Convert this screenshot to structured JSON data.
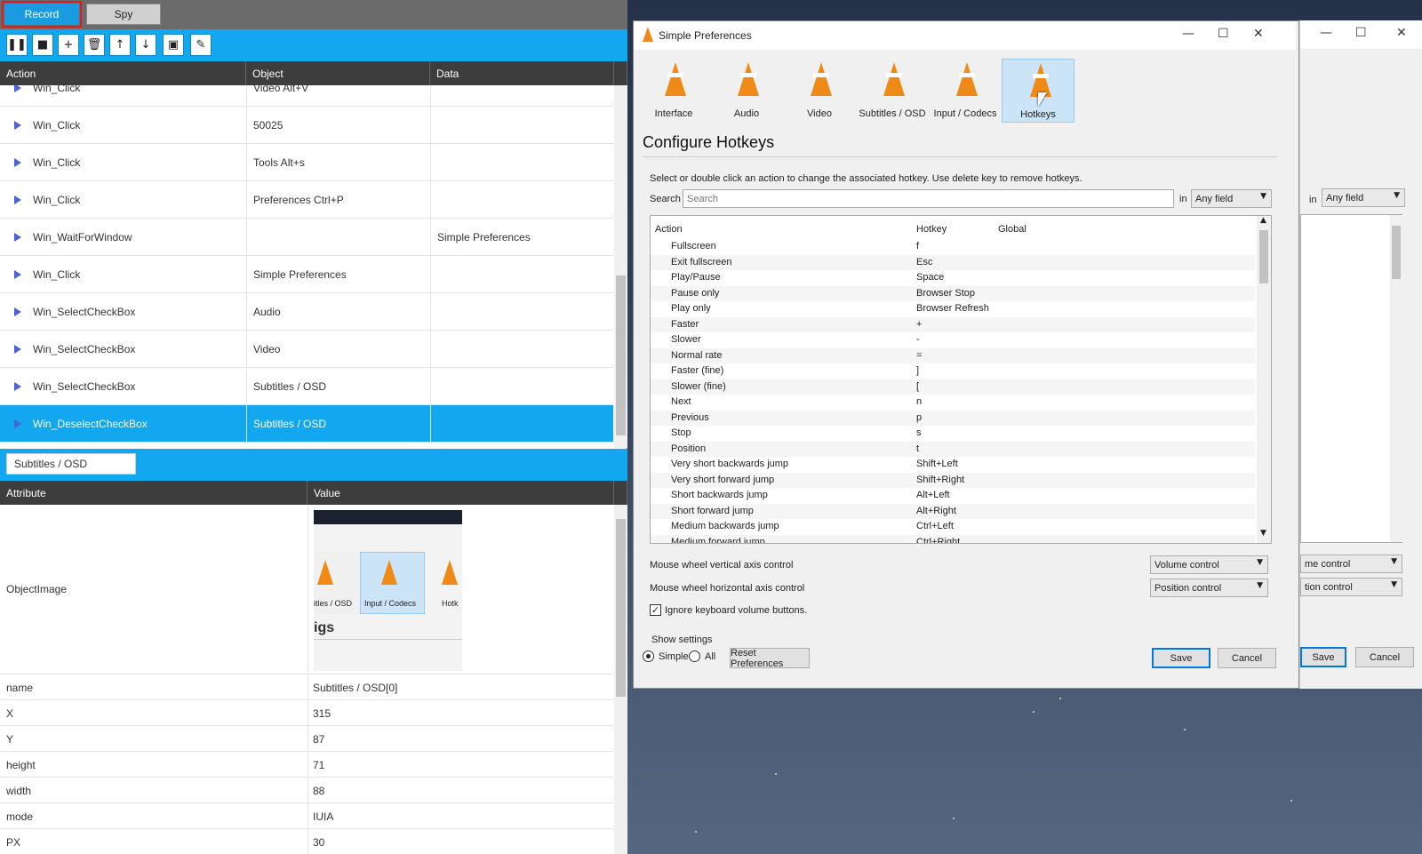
{
  "recorder": {
    "tabs": {
      "record": "Record",
      "spy": "Spy"
    },
    "toolbar": [
      "pause-icon",
      "stop-icon",
      "add-icon",
      "delete-icon",
      "move-up-icon",
      "move-down-icon",
      "image-icon",
      "picker-icon"
    ],
    "columns": {
      "action": "Action",
      "object": "Object",
      "data": "Data"
    },
    "rows": [
      {
        "action": "Win_Click",
        "object": "Video Alt+V",
        "data": ""
      },
      {
        "action": "Win_Click",
        "object": "50025",
        "data": ""
      },
      {
        "action": "Win_Click",
        "object": "Tools Alt+s",
        "data": ""
      },
      {
        "action": "Win_Click",
        "object": "Preferences Ctrl+P",
        "data": ""
      },
      {
        "action": "Win_WaitForWindow",
        "object": "",
        "data": "Simple Preferences"
      },
      {
        "action": "Win_Click",
        "object": "Simple Preferences",
        "data": ""
      },
      {
        "action": "Win_SelectCheckBox",
        "object": "Audio",
        "data": ""
      },
      {
        "action": "Win_SelectCheckBox",
        "object": "Video",
        "data": ""
      },
      {
        "action": "Win_SelectCheckBox",
        "object": "Subtitles / OSD",
        "data": ""
      },
      {
        "action": "Win_DeselectCheckBox",
        "object": "Subtitles / OSD",
        "data": ""
      }
    ],
    "selected_object": "Subtitles / OSD",
    "attr_columns": {
      "attribute": "Attribute",
      "value": "Value"
    },
    "object_image": {
      "label": "ObjectImage",
      "thumb_labels": [
        "itles / OSD",
        "Input / Codecs",
        "Hotk"
      ],
      "thumb_heading": "igs"
    },
    "attributes": [
      {
        "name": "name",
        "value": "Subtitles / OSD[0]"
      },
      {
        "name": "X",
        "value": "315"
      },
      {
        "name": "Y",
        "value": "87"
      },
      {
        "name": "height",
        "value": "71"
      },
      {
        "name": "width",
        "value": "88"
      },
      {
        "name": "mode",
        "value": "IUIA"
      },
      {
        "name": "PX",
        "value": "30"
      }
    ]
  },
  "vlc": {
    "title": "Simple Preferences",
    "nav": [
      "Interface",
      "Audio",
      "Video",
      "Subtitles / OSD",
      "Input / Codecs",
      "Hotkeys"
    ],
    "heading": "Configure Hotkeys",
    "instructions": "Select or double click an action to change the associated hotkey. Use delete key to remove hotkeys.",
    "search_label": "Search",
    "search_placeholder": "Search",
    "in_label": "in",
    "in_value": "Any field",
    "columns": {
      "action": "Action",
      "hotkey": "Hotkey",
      "global": "Global"
    },
    "hotkeys": [
      {
        "action": "Fullscreen",
        "hotkey": "f"
      },
      {
        "action": "Exit fullscreen",
        "hotkey": "Esc"
      },
      {
        "action": "Play/Pause",
        "hotkey": "Space"
      },
      {
        "action": "Pause only",
        "hotkey": "Browser Stop"
      },
      {
        "action": "Play only",
        "hotkey": "Browser Refresh"
      },
      {
        "action": "Faster",
        "hotkey": "+"
      },
      {
        "action": "Slower",
        "hotkey": "-"
      },
      {
        "action": "Normal rate",
        "hotkey": "="
      },
      {
        "action": "Faster (fine)",
        "hotkey": "]"
      },
      {
        "action": "Slower (fine)",
        "hotkey": "["
      },
      {
        "action": "Next",
        "hotkey": "n"
      },
      {
        "action": "Previous",
        "hotkey": "p"
      },
      {
        "action": "Stop",
        "hotkey": "s"
      },
      {
        "action": "Position",
        "hotkey": "t"
      },
      {
        "action": "Very short backwards jump",
        "hotkey": "Shift+Left"
      },
      {
        "action": "Very short forward jump",
        "hotkey": "Shift+Right"
      },
      {
        "action": "Short backwards jump",
        "hotkey": "Alt+Left"
      },
      {
        "action": "Short forward jump",
        "hotkey": "Alt+Right"
      },
      {
        "action": "Medium backwards jump",
        "hotkey": "Ctrl+Left"
      },
      {
        "action": "Medium forward jump",
        "hotkey": "Ctrl+Right"
      }
    ],
    "mouse_vertical_label": "Mouse wheel vertical axis control",
    "mouse_vertical_value": "Volume control",
    "mouse_horizontal_label": "Mouse wheel horizontal axis control",
    "mouse_horizontal_value": "Position control",
    "ignore_keyboard_label": "Ignore keyboard volume buttons.",
    "show_settings_label": "Show settings",
    "simple_label": "Simple",
    "all_label": "All",
    "reset_label": "Reset Preferences",
    "save_label": "Save",
    "cancel_label": "Cancel"
  },
  "ghost": {
    "in_label": "in",
    "in_value": "Any field",
    "vertical_value": "me control",
    "horizontal_value": "tion control",
    "save_label": "Save",
    "cancel_label": "Cancel"
  }
}
